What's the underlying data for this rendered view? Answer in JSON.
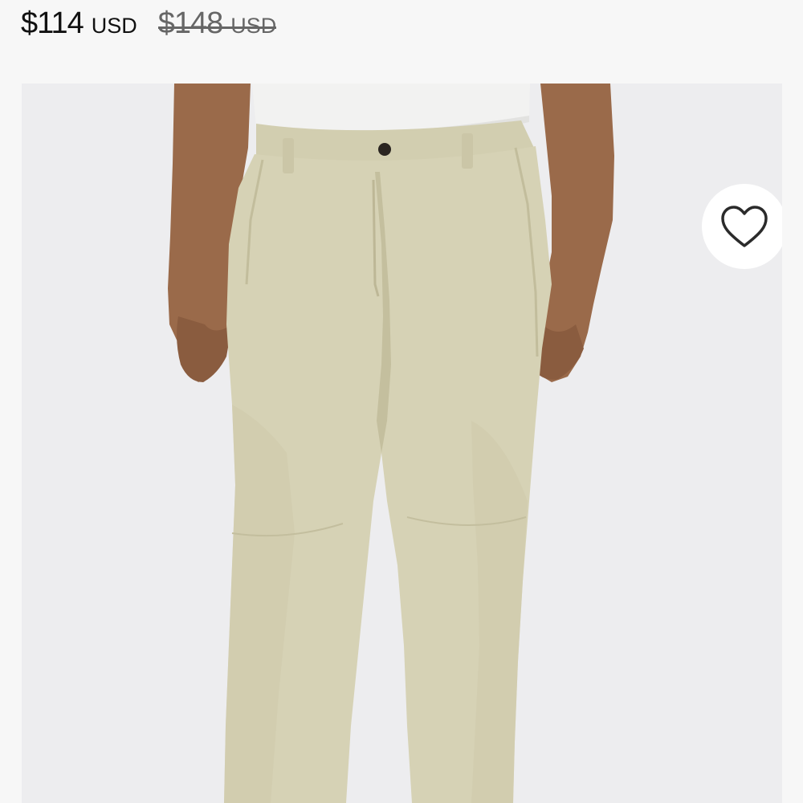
{
  "product": {
    "price": {
      "current": "$114",
      "current_currency": "USD",
      "original": "$148",
      "original_currency": "USD"
    },
    "image": {
      "alt": "Men's khaki pants",
      "pants_color": "#d6d2b5",
      "shirt_color": "#f1f1f0",
      "skin_color": "#9a6a4a",
      "background_color": "#ededef"
    },
    "wishlist": {
      "icon": "heart-outline-icon",
      "label": "Add to wishlist"
    }
  }
}
